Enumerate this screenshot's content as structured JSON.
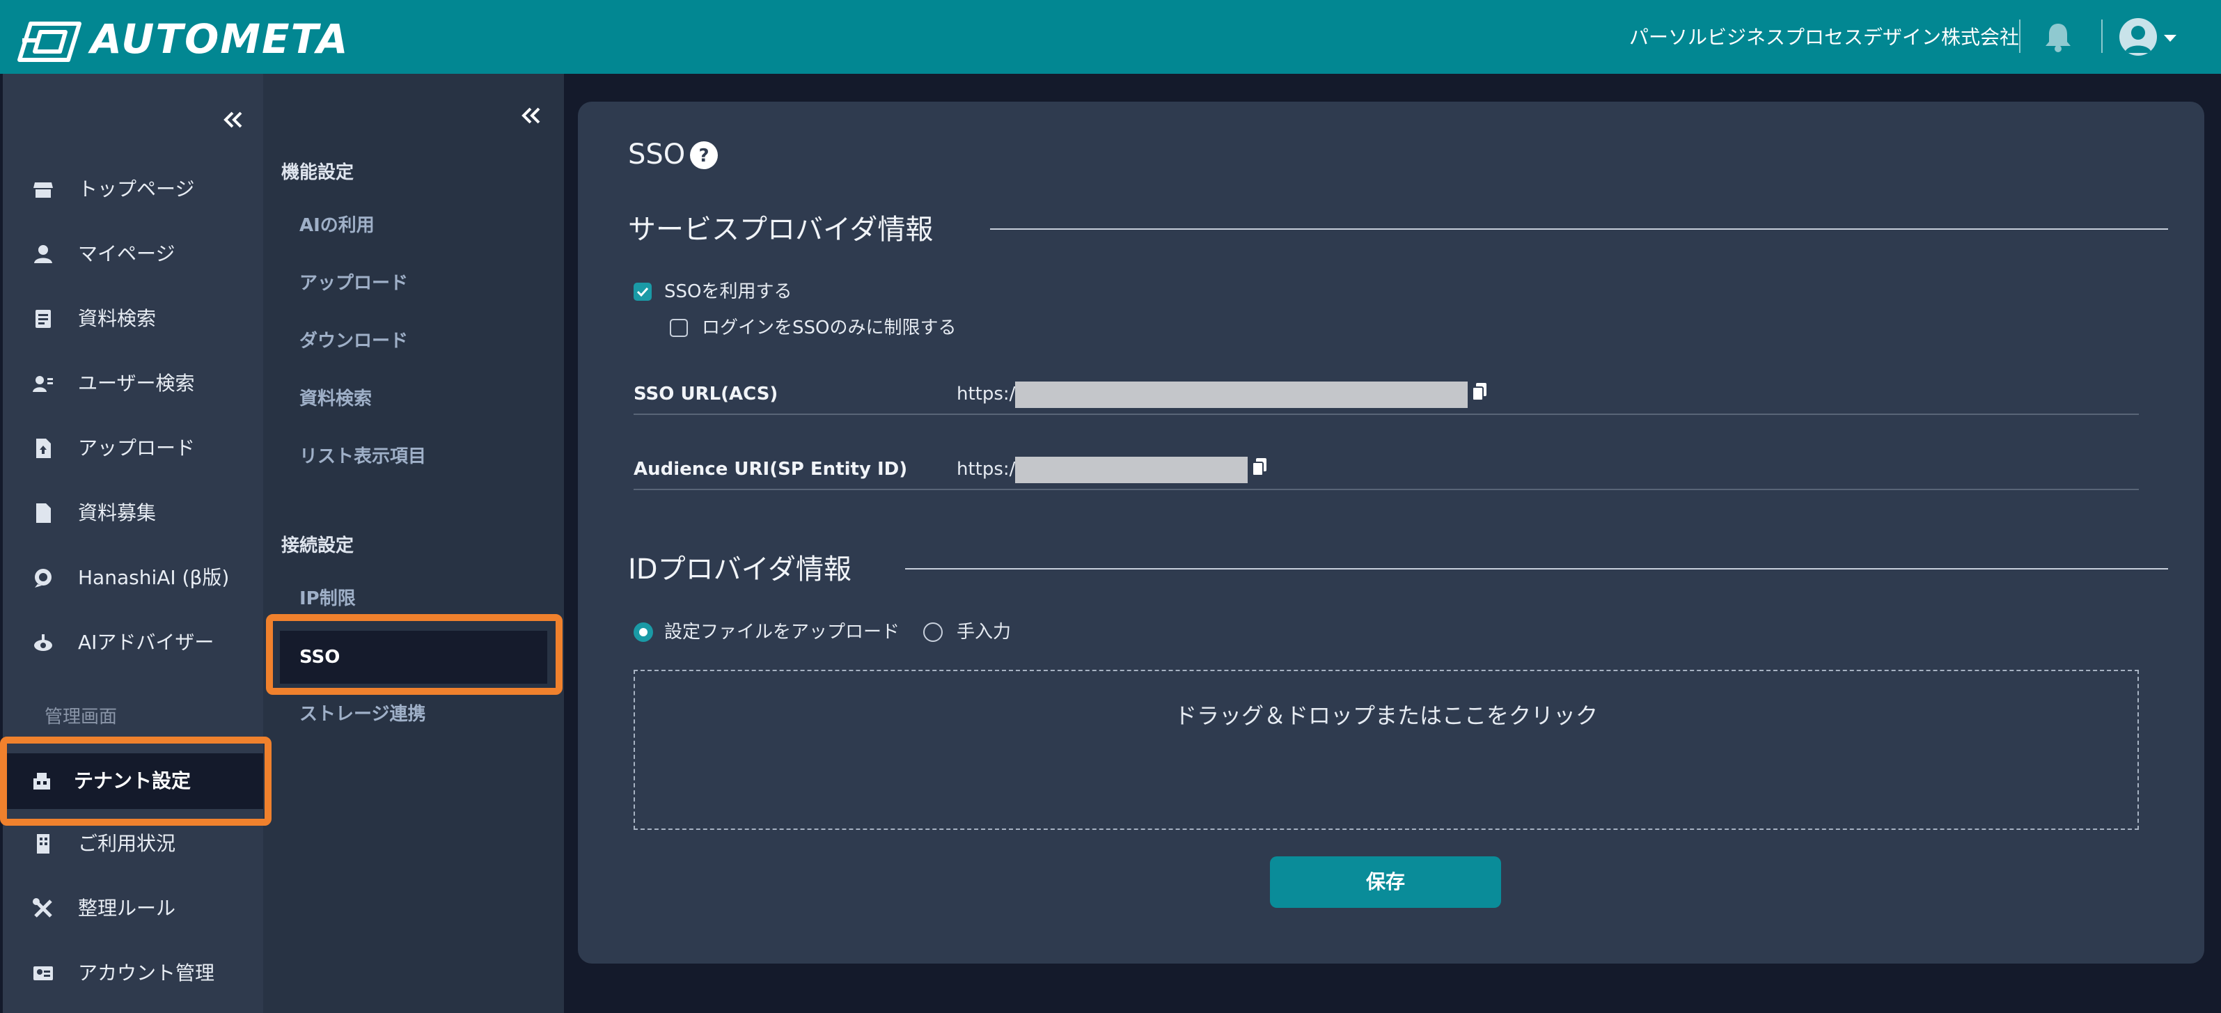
{
  "header": {
    "app_name": "AUTOMETA",
    "company": "パーソルビジネスプロセスデザイン株式会社",
    "icons": [
      "logo-icon",
      "bell-icon",
      "user-avatar-icon",
      "chevron-down-icon"
    ]
  },
  "sidebar": {
    "collapse_icon": "double-chevron-left-icon",
    "items": [
      {
        "label": "トップページ",
        "icon": "store-icon"
      },
      {
        "label": "マイページ",
        "icon": "person-icon"
      },
      {
        "label": "資料検索",
        "icon": "document-search-icon"
      },
      {
        "label": "ユーザー検索",
        "icon": "user-search-icon"
      },
      {
        "label": "アップロード",
        "icon": "file-upload-icon"
      },
      {
        "label": "資料募集",
        "icon": "document-icon"
      },
      {
        "label": "HanashiAI (β版)",
        "icon": "chat-icon"
      },
      {
        "label": "AIアドバイザー",
        "icon": "advisor-icon"
      }
    ],
    "admin_section": "管理画面",
    "admin_items": [
      {
        "label": "テナント設定",
        "icon": "tenant-icon",
        "active": true
      },
      {
        "label": "ご利用状況",
        "icon": "building-icon"
      },
      {
        "label": "整理ルール",
        "icon": "tools-icon"
      },
      {
        "label": "アカウント管理",
        "icon": "id-card-icon"
      }
    ]
  },
  "subnav": {
    "section1": "機能設定",
    "items1": [
      "AIの利用",
      "アップロード",
      "ダウンロード",
      "資料検索",
      "リスト表示項目"
    ],
    "section2": "接続設定",
    "items2": [
      "IP制限",
      "SSO",
      "ストレージ連携"
    ],
    "active": "SSO"
  },
  "main": {
    "title": "SSO",
    "help_icon": "question-circle-icon",
    "sp_section": "サービスプロバイダ情報",
    "use_sso_label": "SSOを利用する",
    "use_sso_checked": true,
    "restrict_label": "ログインをSSOのみに制限する",
    "restrict_checked": false,
    "fields": [
      {
        "label": "SSO URL(ACS)",
        "value": "https://",
        "copy_icon": "copy-icon"
      },
      {
        "label": "Audience URI(SP Entity ID)",
        "value": "https://",
        "copy_icon": "copy-icon"
      }
    ],
    "idp_section": "IDプロバイダ情報",
    "radio_upload_label": "設定ファイルをアップロード",
    "radio_manual_label": "手入力",
    "selected_radio": "設定ファイルをアップロード",
    "dropzone_text": "ドラッグ＆ドロップまたはここをクリック",
    "save_label": "保存"
  },
  "colors": {
    "header": "#028792",
    "accent": "#1a9aa6",
    "highlight": "#f0812d",
    "panel": "#2f3b4f",
    "background": "#141a2b"
  }
}
